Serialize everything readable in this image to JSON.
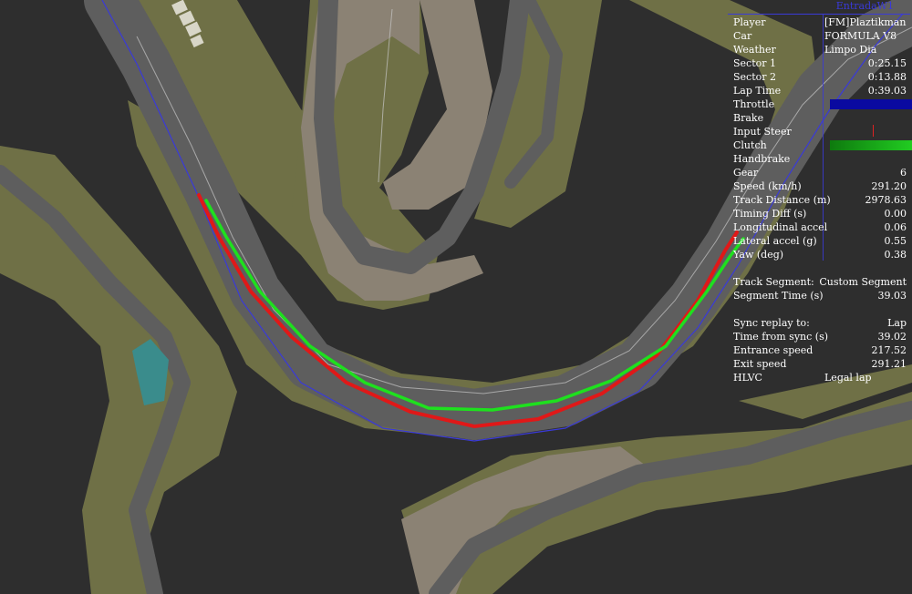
{
  "panel": {
    "header": "EntradaW1",
    "rows": [
      {
        "label": "Player",
        "value": "[FM]Plaztikman",
        "align": "left"
      },
      {
        "label": "Car",
        "value": "FORMULA V8",
        "align": "left"
      },
      {
        "label": "Weather",
        "value": "Limpo Dia",
        "align": "left"
      },
      {
        "label": "Sector 1",
        "value": "0:25.15"
      },
      {
        "label": "Sector 2",
        "value": "0:13.88"
      },
      {
        "label": "Lap Time",
        "value": "0:39.03"
      },
      {
        "label": "Throttle",
        "value": ""
      },
      {
        "label": "Brake",
        "value": ""
      },
      {
        "label": "Input Steer",
        "value": ""
      },
      {
        "label": "Clutch",
        "value": ""
      },
      {
        "label": "Handbrake",
        "value": ""
      },
      {
        "label": "Gear",
        "value": "6"
      },
      {
        "label": "Speed (km/h)",
        "value": "291.20"
      },
      {
        "label": "Track Distance (m)",
        "value": "2978.63"
      },
      {
        "label": "Timing Diff (s)",
        "value": "0.00"
      },
      {
        "label": "Longitudinal accel",
        "value": "0.06"
      },
      {
        "label": "Lateral accel (g)",
        "value": "0.55"
      },
      {
        "label": "Yaw (deg)",
        "value": "0.38"
      },
      {
        "label": "",
        "value": ""
      },
      {
        "label": "Track Segment:",
        "value": "Custom Segment"
      },
      {
        "label": "Segment Time (s)",
        "value": "39.03"
      },
      {
        "label": "",
        "value": ""
      },
      {
        "label": "Sync replay to:",
        "value": "Lap"
      },
      {
        "label": "Time from sync (s)",
        "value": "39.02"
      },
      {
        "label": "Entrance speed",
        "value": "217.52"
      },
      {
        "label": "Exit speed",
        "value": "291.21"
      },
      {
        "label": "HLVC",
        "value": "Legal lap",
        "align": "left"
      }
    ],
    "throttle_level": 1.0,
    "clutch_level": 1.0,
    "steer_level": 0.5,
    "colors": {
      "throttle": "#0a0aa0",
      "clutch": "#22d022",
      "steer_marker": "#dd2222",
      "header": "#3a3ad8"
    }
  },
  "map": {
    "colors": {
      "background": "#2e2e2e",
      "grass": "#6f7046",
      "runoff": "#8b8274",
      "asphalt": "#5e5e5e",
      "kerb_line": "#c8c8c8",
      "racing_line": "#3a3ad8",
      "trace_player": "#1ee01e",
      "trace_reference": "#e01818",
      "water": "#3a8c8c"
    }
  }
}
